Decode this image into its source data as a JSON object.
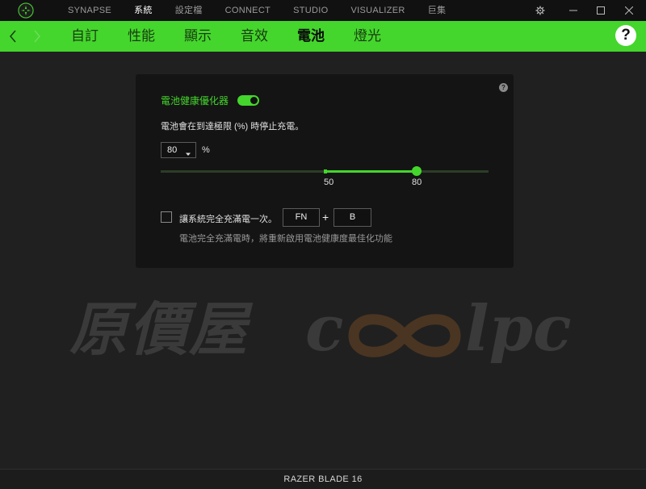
{
  "titlebar": {
    "tabs": [
      "SYNAPSE",
      "系統",
      "設定檔",
      "CONNECT",
      "STUDIO",
      "VISUALIZER",
      "巨集"
    ],
    "active_tab": "系統"
  },
  "subnav": {
    "tabs": [
      "自訂",
      "性能",
      "顯示",
      "音效",
      "電池",
      "燈光"
    ],
    "active_tab": "電池",
    "help_label": "?"
  },
  "battery": {
    "optimizer_label": "電池健康優化器",
    "optimizer_enabled": true,
    "limit_description": "電池會在到達極限 (%) 時停止充電。",
    "limit_value": "80",
    "limit_unit": "%",
    "slider": {
      "min_label": "50",
      "value_label": "80",
      "min": 50,
      "value": 80
    },
    "help_icon": "?",
    "full_charge_label": "讓系統完全充滿電一次。",
    "full_charge_checked": false,
    "shortcut_key1": "FN",
    "shortcut_plus": "+",
    "shortcut_key2": "B",
    "full_charge_note": "電池完全充滿電時，將重新啟用電池健康度最佳化功能"
  },
  "watermark": {
    "text_cn": "原價屋",
    "text_c": "c",
    "text_lpc": "lpc"
  },
  "footer": {
    "device": "RAZER BLADE 16"
  },
  "colors": {
    "accent": "#44d62c",
    "background": "#202020",
    "panel": "#141414"
  }
}
